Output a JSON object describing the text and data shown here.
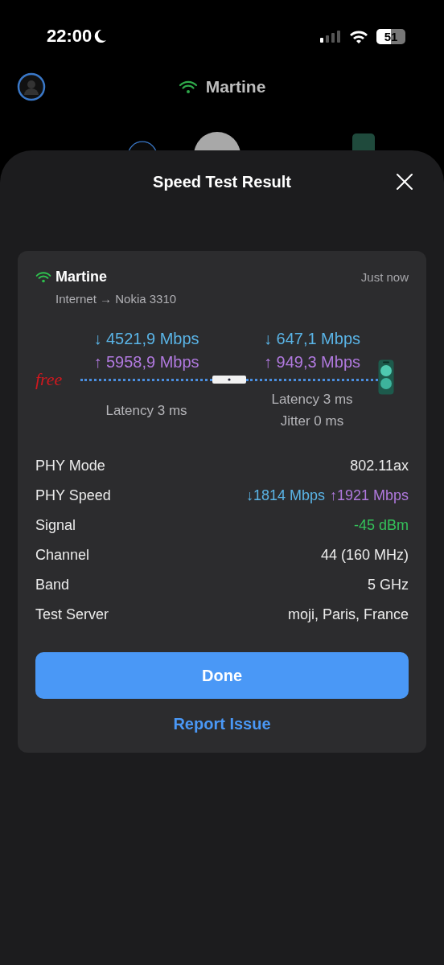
{
  "status_bar": {
    "time": "22:00",
    "battery": "51"
  },
  "header": {
    "network": "Martine"
  },
  "sheet": {
    "title": "Speed Test Result",
    "card": {
      "network": "Martine",
      "route": "Internet → Nokia 3310",
      "time": "Just now",
      "isp_logo": "free",
      "hops": [
        {
          "speeds": [
            {
              "kind": "down",
              "text": "↓ 4521,9 Mbps"
            },
            {
              "kind": "up",
              "text": "↑ 5958,9 Mbps"
            }
          ],
          "notes": [
            "Latency 3 ms"
          ]
        },
        {
          "speeds": [
            {
              "kind": "down",
              "text": "↓ 647,1 Mbps"
            },
            {
              "kind": "up",
              "text": "↑ 949,3 Mbps"
            }
          ],
          "notes": [
            "Latency 3 ms",
            "Jitter 0 ms"
          ]
        }
      ],
      "details": [
        {
          "label": "PHY Mode",
          "values": [
            {
              "kind": "plain",
              "text": "802.11ax"
            }
          ]
        },
        {
          "label": "PHY Speed",
          "values": [
            {
              "kind": "down",
              "text": "↓1814 Mbps"
            },
            {
              "kind": "up",
              "text": "↑1921 Mbps"
            }
          ]
        },
        {
          "label": "Signal",
          "values": [
            {
              "kind": "good",
              "text": "-45 dBm"
            }
          ]
        },
        {
          "label": "Channel",
          "values": [
            {
              "kind": "plain",
              "text": "44 (160 MHz)"
            }
          ]
        },
        {
          "label": "Band",
          "values": [
            {
              "kind": "plain",
              "text": "5 GHz"
            }
          ]
        },
        {
          "label": "Test Server",
          "values": [
            {
              "kind": "plain",
              "text": "moji, Paris, France"
            }
          ]
        }
      ],
      "buttons": [
        {
          "kind": "primary",
          "label": "Done"
        },
        {
          "kind": "link",
          "label": "Report Issue"
        }
      ]
    }
  }
}
